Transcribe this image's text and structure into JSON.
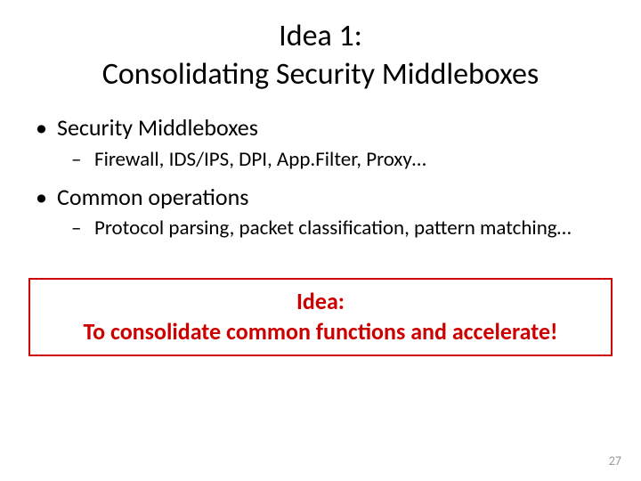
{
  "title_line1": "Idea 1:",
  "title_line2": "Consolidating Security Middleboxes",
  "bullets": {
    "b1": "Security Middleboxes",
    "b1_sub": "Firewall, IDS/IPS, DPI, App.Filter, Proxy…",
    "b2": "Common operations",
    "b2_sub": "Protocol parsing, packet classification, pattern matching…"
  },
  "callout": {
    "line1": "Idea:",
    "line2": "To consolidate common functions and accelerate!"
  },
  "page_number": "27"
}
